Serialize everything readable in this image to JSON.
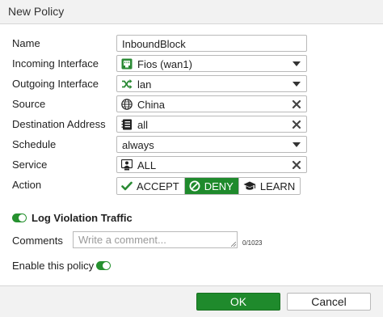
{
  "dialog": {
    "title": "New Policy"
  },
  "form": {
    "name": {
      "label": "Name",
      "value": "InboundBlock"
    },
    "incoming_interface": {
      "label": "Incoming Interface",
      "value": "Fios (wan1)",
      "icon": "wan-port-icon"
    },
    "outgoing_interface": {
      "label": "Outgoing Interface",
      "value": "lan",
      "icon": "shuffle-icon"
    },
    "source": {
      "label": "Source",
      "value": "China",
      "icon": "globe-icon"
    },
    "destination_address": {
      "label": "Destination Address",
      "value": "all",
      "icon": "address-book-icon"
    },
    "schedule": {
      "label": "Schedule",
      "value": "always"
    },
    "service": {
      "label": "Service",
      "value": "ALL",
      "icon": "service-icon"
    },
    "action": {
      "label": "Action",
      "options": [
        {
          "label": "ACCEPT",
          "icon": "check-icon",
          "active": false
        },
        {
          "label": "DENY",
          "icon": "deny-icon",
          "active": true
        },
        {
          "label": "LEARN",
          "icon": "graduation-cap-icon",
          "active": false
        }
      ]
    },
    "log_violation": {
      "label": "Log Violation Traffic",
      "enabled": true
    },
    "comments": {
      "label": "Comments",
      "placeholder": "Write a comment...",
      "value": "",
      "counter": "0/1023"
    },
    "enable_policy": {
      "label": "Enable this policy",
      "enabled": true
    }
  },
  "footer": {
    "ok_label": "OK",
    "cancel_label": "Cancel"
  },
  "colors": {
    "accent_green": "#1f8a2c",
    "toggle_green": "#26912f",
    "titlebar_bg": "#f2f2f2"
  }
}
